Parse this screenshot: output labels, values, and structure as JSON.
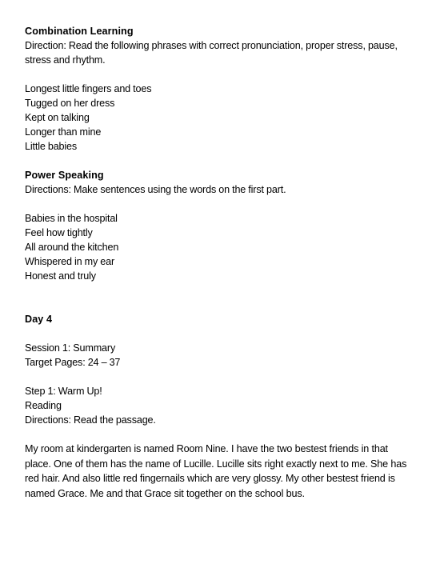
{
  "document": {
    "sections": [
      {
        "id": "combination-learning",
        "heading": "Combination Learning",
        "direction": "Direction: Read the following phrases with correct pronunciation, proper stress, pause, stress and rhythm.",
        "items": [
          "Longest little fingers and toes",
          "Tugged on her dress",
          "Kept on talking",
          "Longer than mine",
          "Little babies"
        ]
      },
      {
        "id": "power-speaking",
        "heading": "Power Speaking",
        "direction": "Directions: Make sentences using the words on the first part.",
        "items": [
          "Babies in the hospital",
          "Feel how tightly",
          "All around the kitchen",
          "Whispered in my ear",
          "Honest and truly"
        ]
      }
    ],
    "day": {
      "heading": "Day 4",
      "session": "Session 1: Summary",
      "target_pages": "Target Pages: 24 – 37",
      "step": "Step 1: Warm Up!",
      "activity": "Reading",
      "direction": "Directions: Read the passage.",
      "passage": "My room at kindergarten is named Room Nine. I have the two bestest friends in that place. One of them has the name of Lucille. Lucille sits right exactly next to me. She has red hair. And also little red fingernails which are very glossy. My other bestest friend is named Grace. Me and that Grace sit together on the school bus."
    }
  }
}
